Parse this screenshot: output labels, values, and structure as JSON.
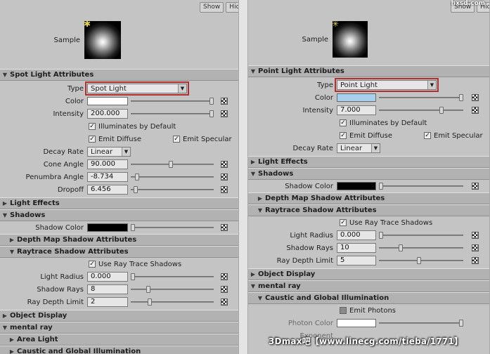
{
  "top_buttons": {
    "show": "Show",
    "hide": "Hide"
  },
  "logo_text": "hxsd.com",
  "watermark": "3Dmax吧【www.linecg.com/tieba/1771】",
  "left": {
    "sample_label": "Sample",
    "sections": {
      "spot": "Spot Light Attributes",
      "light_effects": "Light Effects",
      "shadows": "Shadows",
      "depth_map": "Depth Map Shadow Attributes",
      "raytrace": "Raytrace Shadow Attributes",
      "object_display": "Object Display",
      "mental_ray": "mental ray",
      "area_light": "Area Light",
      "caustic": "Caustic and Global Illumination"
    },
    "type_label": "Type",
    "type_value": "Spot Light",
    "color_label": "Color",
    "color_value": "#ffffff",
    "intensity_label": "Intensity",
    "intensity_value": "200.000",
    "illuminates_label": "Illuminates by Default",
    "emit_diffuse_label": "Emit Diffuse",
    "emit_specular_label": "Emit Specular",
    "decay_label": "Decay Rate",
    "decay_value": "Linear",
    "cone_label": "Cone Angle",
    "cone_value": "90.000",
    "penumbra_label": "Penumbra Angle",
    "penumbra_value": "-8.734",
    "dropoff_label": "Dropoff",
    "dropoff_value": "6.456",
    "shadow_color_label": "Shadow Color",
    "shadow_color_value": "#000000",
    "use_ray_label": "Use Ray Trace Shadows",
    "light_radius_label": "Light Radius",
    "light_radius_value": "0.000",
    "shadow_rays_label": "Shadow Rays",
    "shadow_rays_value": "8",
    "ray_depth_label": "Ray Depth Limit",
    "ray_depth_value": "2"
  },
  "right": {
    "sample_label": "Sample",
    "sections": {
      "point": "Point Light Attributes",
      "light_effects": "Light Effects",
      "shadows": "Shadows",
      "depth_map": "Depth Map Shadow Attributes",
      "raytrace": "Raytrace Shadow Attributes",
      "object_display": "Object Display",
      "mental_ray": "mental ray",
      "caustic": "Caustic and Global Illumination"
    },
    "type_label": "Type",
    "type_value": "Point Light",
    "color_label": "Color",
    "color_value": "#a8d0ec",
    "intensity_label": "Intensity",
    "intensity_value": "7.000",
    "illuminates_label": "Illuminates by Default",
    "emit_diffuse_label": "Emit Diffuse",
    "emit_specular_label": "Emit Specular",
    "decay_label": "Decay Rate",
    "decay_value": "Linear",
    "shadow_color_label": "Shadow Color",
    "shadow_color_value": "#000000",
    "use_ray_label": "Use Ray Trace Shadows",
    "light_radius_label": "Light Radius",
    "light_radius_value": "0.000",
    "shadow_rays_label": "Shadow Rays",
    "shadow_rays_value": "10",
    "ray_depth_label": "Ray Depth Limit",
    "ray_depth_value": "5",
    "emit_photons_label": "Emit Photons",
    "photon_color_label": "Photon Color",
    "photon_color_value": "#ffffff",
    "exponent_label": "Exponent"
  }
}
